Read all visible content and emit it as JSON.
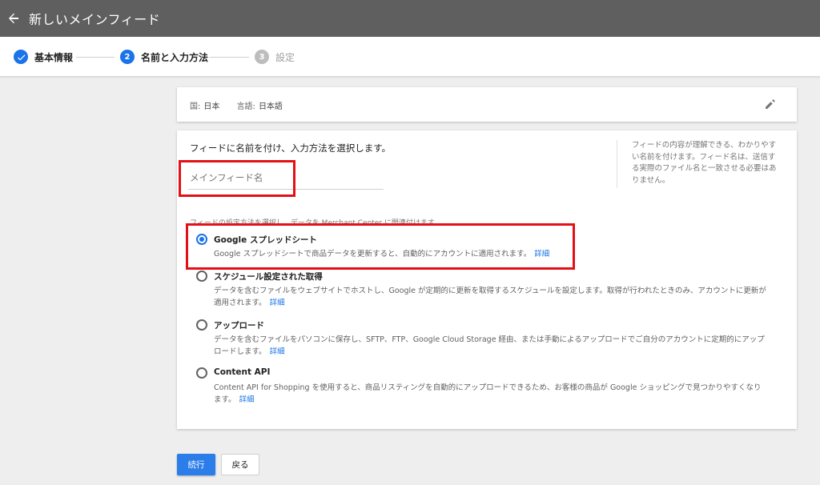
{
  "header": {
    "title": "新しいメインフィード",
    "back_icon": "arrow-left-icon"
  },
  "steps": [
    {
      "number": "✓",
      "label": "基本情報",
      "state": "done"
    },
    {
      "number": "2",
      "label": "名前と入力方法",
      "state": "active"
    },
    {
      "number": "3",
      "label": "設定",
      "state": "pending"
    }
  ],
  "locale": {
    "country_key": "国:",
    "country_value": "日本",
    "language_key": "言語:",
    "language_value": "日本語",
    "edit_icon": "pencil-icon"
  },
  "form": {
    "heading": "フィードに名前を付け、入力方法を選択します。",
    "name_placeholder": "メインフィード名",
    "help_text": "フィードの内容が理解できる、わかりやすい名前を付けます。フィード名は、送信する実際のファイル名と一致させる必要はありません。",
    "method_label": "フィードの設定方法を選択し、データを Merchant Center に関連付けます。",
    "options": [
      {
        "title": "Google スプレッドシート",
        "desc": "Google スプレッドシートで商品データを更新すると、自動的にアカウントに適用されます。",
        "link": "詳細",
        "selected": true
      },
      {
        "title": "スケジュール設定された取得",
        "desc": "データを含むファイルをウェブサイトでホストし、Google が定期的に更新を取得するスケジュールを設定します。取得が行われたときのみ、アカウントに更新が適用されます。",
        "link": "詳細",
        "selected": false
      },
      {
        "title": "アップロード",
        "desc": "データを含むファイルをパソコンに保存し、SFTP、FTP、Google Cloud Storage 経由、または手動によるアップロードでご自分のアカウントに定期的にアップロードします。",
        "link": "詳細",
        "selected": false
      },
      {
        "title": "Content API",
        "desc": "Content API for Shopping を使用すると、商品リスティングを自動的にアップロードできるため、お客様の商品が Google ショッピングで見つかりやすくなります。",
        "link": "詳細",
        "selected": false
      }
    ]
  },
  "buttons": {
    "continue": "続行",
    "back": "戻る"
  },
  "colors": {
    "accent": "#1a73e8",
    "highlight": "#e31016",
    "topbar": "#5f5f5f"
  }
}
